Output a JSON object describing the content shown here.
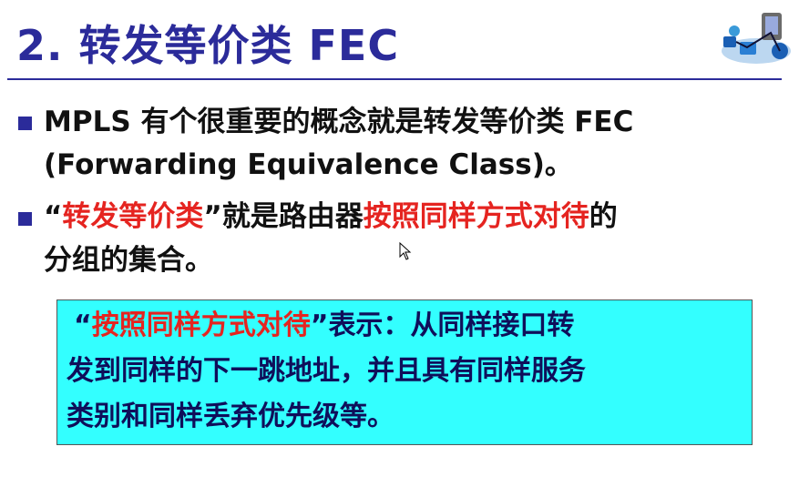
{
  "slide": {
    "title": "2.  转发等价类 FEC",
    "logo_icon": "network-logo-icon"
  },
  "bullets": [
    {
      "line1": "MPLS 有个很重要的概念就是转发等价类 FEC",
      "line2": "(Forwarding Equivalence Class)。"
    },
    {
      "quote_open": "“",
      "term": "转发等价类",
      "quote_close": "”",
      "mid": "就是路由器",
      "emph": "按照同样方式对待",
      "tail": "的",
      "line2": "分组的集合。"
    }
  ],
  "callout": {
    "quote_open": "“",
    "term": "按照同样方式对待",
    "quote_close": "”",
    "line1_rest": "表示：从同样接口转",
    "line2": "发到同样的下一跳地址，并且具有同样服务",
    "line3": "类别和同样丢弃优先级等。",
    "background": "#33ffff"
  },
  "colors": {
    "title": "#2b2b9a",
    "emphasis": "#e52420",
    "body": "#111111"
  }
}
